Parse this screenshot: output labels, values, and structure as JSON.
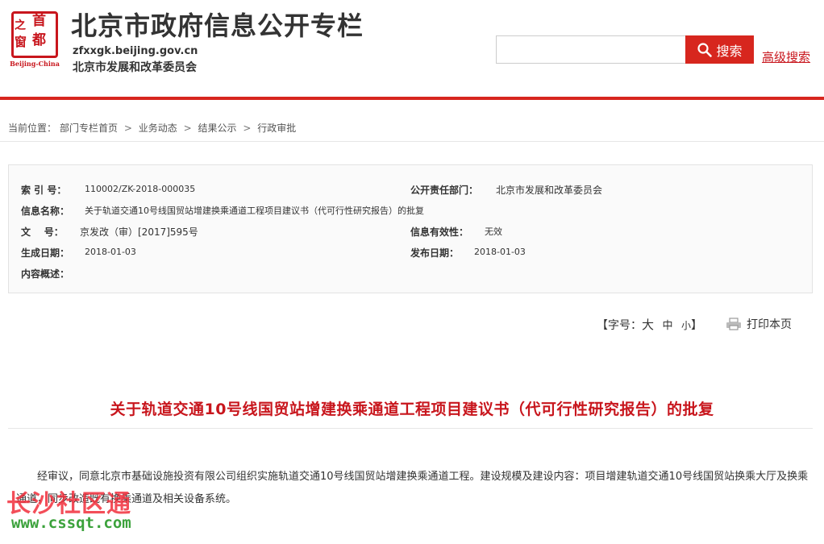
{
  "header": {
    "logo": {
      "chars": [
        "之",
        "首",
        "窗",
        "都"
      ],
      "caption": "Beijing-China"
    },
    "title": "北京市政府信息公开专栏",
    "url": "zfxxgk.beijing.gov.cn",
    "org": "北京市发展和改革委员会",
    "search_button": "搜索",
    "advanced_search": "高级搜索"
  },
  "breadcrumb": {
    "prefix": "当前位置：",
    "items": [
      "部门专栏首页",
      "业务动态",
      "结果公示",
      "行政审批"
    ],
    "separator": ">"
  },
  "info": {
    "index_label": "索 引 号：",
    "index_value": "110002/ZK-2018-000035",
    "dept_label": "公开责任部门：",
    "dept_value": "北京市发展和改革委员会",
    "name_label": "信息名称：",
    "name_value": "关于轨道交通10号线国贸站增建换乘通道工程项目建议书（代可行性研究报告）的批复",
    "doc_label": "文    号：",
    "doc_value": "京发改（审）[2017]595号",
    "validity_label": "信息有效性：",
    "validity_value": "无效",
    "created_label": "生成日期：",
    "created_value": "2018-01-03",
    "published_label": "发布日期：",
    "published_value": "2018-01-03",
    "summary_label": "内容概述："
  },
  "tools": {
    "font_size_open": "【字号：",
    "font_large": "大",
    "font_medium": "中",
    "font_small": "小",
    "font_size_close": "】",
    "print": "打印本页"
  },
  "article": {
    "title": "关于轨道交通10号线国贸站增建换乘通道工程项目建议书（代可行性研究报告）的批复",
    "body": "经审议，同意北京市基础设施投资有限公司组织实施轨道交通10号线国贸站增建换乘通道工程。建设规模及建设内容：项目增建轨道交通10号线国贸站换乘大厅及换乘通道，同步改造既有换乘通道及相关设备系统。"
  },
  "watermark": {
    "name": "长沙社区通",
    "url": "www.cssqt.com"
  },
  "colors": {
    "brand_red": "#d7261e",
    "title_red": "#c8161d"
  }
}
